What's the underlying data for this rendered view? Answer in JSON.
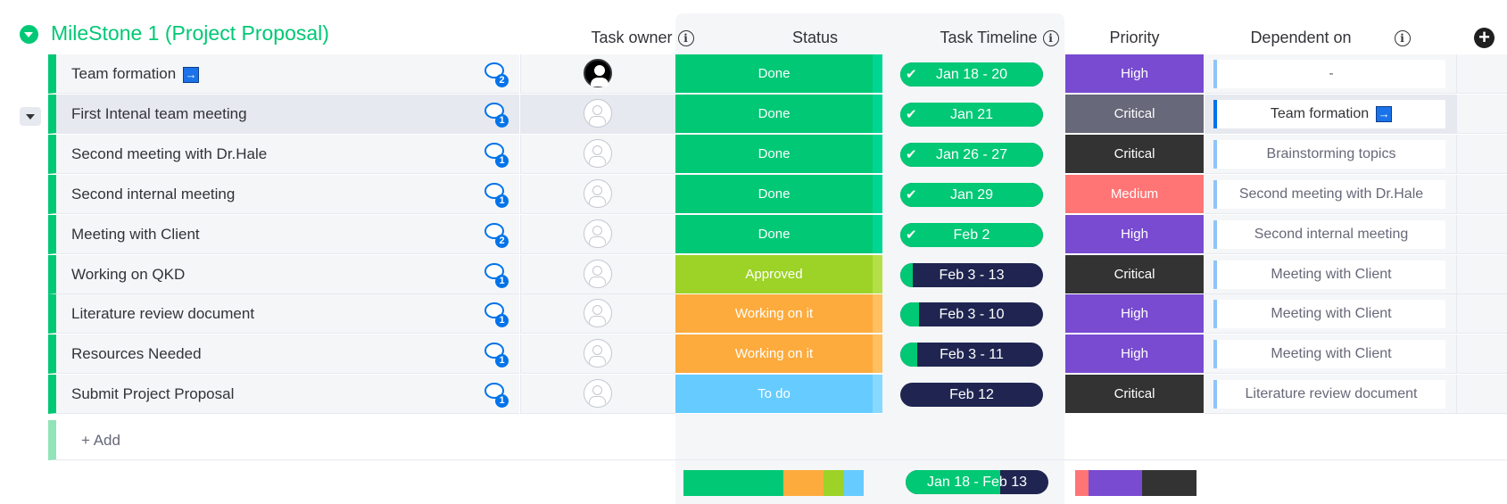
{
  "group": {
    "title": "MileStone 1 (Project Proposal)",
    "color": "#00c875"
  },
  "columns": {
    "owner": "Task owner",
    "status": "Status",
    "timeline": "Task Timeline",
    "priority": "Priority",
    "dependent": "Dependent on",
    "add_column": "+"
  },
  "rows": [
    {
      "name": "Team formation",
      "link": true,
      "comments": "2",
      "owner_avatar": "filled",
      "status": "Done",
      "status_color": "#00c875",
      "timeline": "Jan 18 - 20",
      "timeline_progress": 1.0,
      "timeline_done": true,
      "priority": "High",
      "priority_color": "#784bd1",
      "dependent": "-"
    },
    {
      "name": "First Intenal team meeting",
      "link": false,
      "comments": "1",
      "owner_avatar": "empty",
      "status": "Done",
      "status_color": "#00c875",
      "timeline": "Jan 21",
      "timeline_progress": 1.0,
      "timeline_done": true,
      "priority": "Critical",
      "priority_color": "#676879",
      "dependent": "Team formation",
      "dependent_link": true
    },
    {
      "name": "Second meeting with Dr.Hale",
      "link": false,
      "comments": "1",
      "owner_avatar": "empty",
      "status": "Done",
      "status_color": "#00c875",
      "timeline": "Jan 26 - 27",
      "timeline_progress": 1.0,
      "timeline_done": true,
      "priority": "Critical",
      "priority_color": "#333333",
      "dependent": "Brainstorming topics"
    },
    {
      "name": "Second internal meeting",
      "link": false,
      "comments": "1",
      "owner_avatar": "empty",
      "status": "Done",
      "status_color": "#00c875",
      "timeline": "Jan 29",
      "timeline_progress": 1.0,
      "timeline_done": true,
      "priority": "Medium",
      "priority_color": "#ff7575",
      "dependent": "Second meeting with Dr.Hale"
    },
    {
      "name": "Meeting with Client",
      "link": false,
      "comments": "2",
      "owner_avatar": "empty",
      "status": "Done",
      "status_color": "#00c875",
      "timeline": "Feb 2",
      "timeline_progress": 1.0,
      "timeline_done": true,
      "priority": "High",
      "priority_color": "#784bd1",
      "dependent": "Second internal meeting"
    },
    {
      "name": "Working on QKD",
      "link": false,
      "comments": "1",
      "owner_avatar": "empty",
      "status": "Approved",
      "status_color": "#9cd326",
      "timeline": "Feb 3 - 13",
      "timeline_progress": 0.09,
      "timeline_done": false,
      "priority": "Critical",
      "priority_color": "#333333",
      "dependent": "Meeting with Client"
    },
    {
      "name": "Literature review document",
      "link": false,
      "comments": "1",
      "owner_avatar": "empty",
      "status": "Working on it",
      "status_color": "#fdab3d",
      "timeline": "Feb 3 - 10",
      "timeline_progress": 0.13,
      "timeline_done": false,
      "priority": "High",
      "priority_color": "#784bd1",
      "dependent": "Meeting with Client"
    },
    {
      "name": "Resources Needed",
      "link": false,
      "comments": "1",
      "owner_avatar": "empty",
      "status": "Working on it",
      "status_color": "#fdab3d",
      "timeline": "Feb 3 - 11",
      "timeline_progress": 0.12,
      "timeline_done": false,
      "priority": "High",
      "priority_color": "#784bd1",
      "dependent": "Meeting with Client"
    },
    {
      "name": "Submit Project Proposal",
      "link": false,
      "comments": "1",
      "owner_avatar": "empty",
      "status": "To do",
      "status_color": "#66ccff",
      "timeline": "Feb 12",
      "timeline_progress": 0.0,
      "timeline_done": false,
      "priority": "Critical",
      "priority_color": "#333333",
      "dependent": "Literature review document"
    }
  ],
  "add_item": "+ Add",
  "summary": {
    "status_distribution": [
      {
        "label": "Done",
        "fraction": 0.556,
        "color": "#00c875"
      },
      {
        "label": "Working on it",
        "fraction": 0.222,
        "color": "#fdab3d"
      },
      {
        "label": "Approved",
        "fraction": 0.111,
        "color": "#9cd326"
      },
      {
        "label": "To do",
        "fraction": 0.111,
        "color": "#66ccff"
      }
    ],
    "timeline": "Jan 18 - Feb 13",
    "timeline_progress": 0.66,
    "priority_distribution": [
      {
        "label": "Medium",
        "fraction": 0.111,
        "color": "#ff7575"
      },
      {
        "label": "High",
        "fraction": 0.444,
        "color": "#784bd1"
      },
      {
        "label": "Critical",
        "fraction": 0.444,
        "color": "#333333"
      }
    ]
  }
}
